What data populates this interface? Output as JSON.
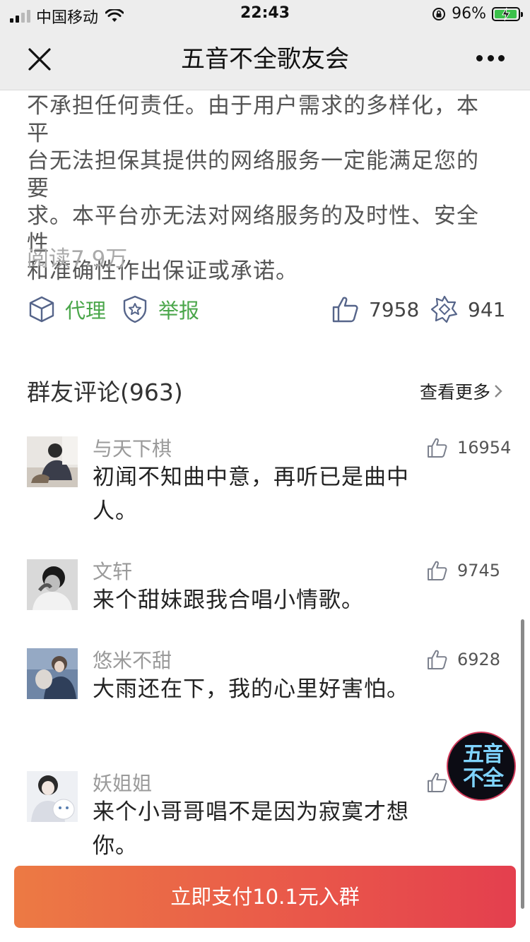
{
  "status_bar": {
    "carrier": "中国移动",
    "time": "22:43",
    "battery_percent": "96%"
  },
  "nav": {
    "title": "五音不全歌友会"
  },
  "article": {
    "lines": [
      "不承担任何责任。由于用户需求的多样化，本平",
      "台无法担保其提供的网络服务一定能满足您的要",
      "求。本平台亦无法对网络服务的及时性、安全性",
      "和准确性作出保证或承诺。"
    ],
    "read_count": "阅读7.9万"
  },
  "actions": {
    "agent_label": "代理",
    "report_label": "举报",
    "like_count": "7958",
    "share_count": "941"
  },
  "comments_section": {
    "title": "群友评论(963)",
    "see_more": "查看更多",
    "items": [
      {
        "name": "与天下棋",
        "text": "初闻不知曲中意，再听已是曲中人。",
        "likes": "16954"
      },
      {
        "name": "文轩",
        "text": "来个甜妹跟我合唱小情歌。",
        "likes": "9745"
      },
      {
        "name": "悠米不甜",
        "text": "大雨还在下，我的心里好害怕。",
        "likes": "6928"
      },
      {
        "name": "妖姐姐",
        "text": "来个小哥哥唱不是因为寂寞才想你。",
        "likes": ""
      }
    ]
  },
  "float_badge": {
    "text": "五音不全"
  },
  "pay_button": {
    "label": "立即支付10.1元入群"
  },
  "colors": {
    "green": "#4aa64a",
    "pay_start": "#ec7a44",
    "pay_end": "#e43f4e",
    "header_bg": "#ededed"
  }
}
